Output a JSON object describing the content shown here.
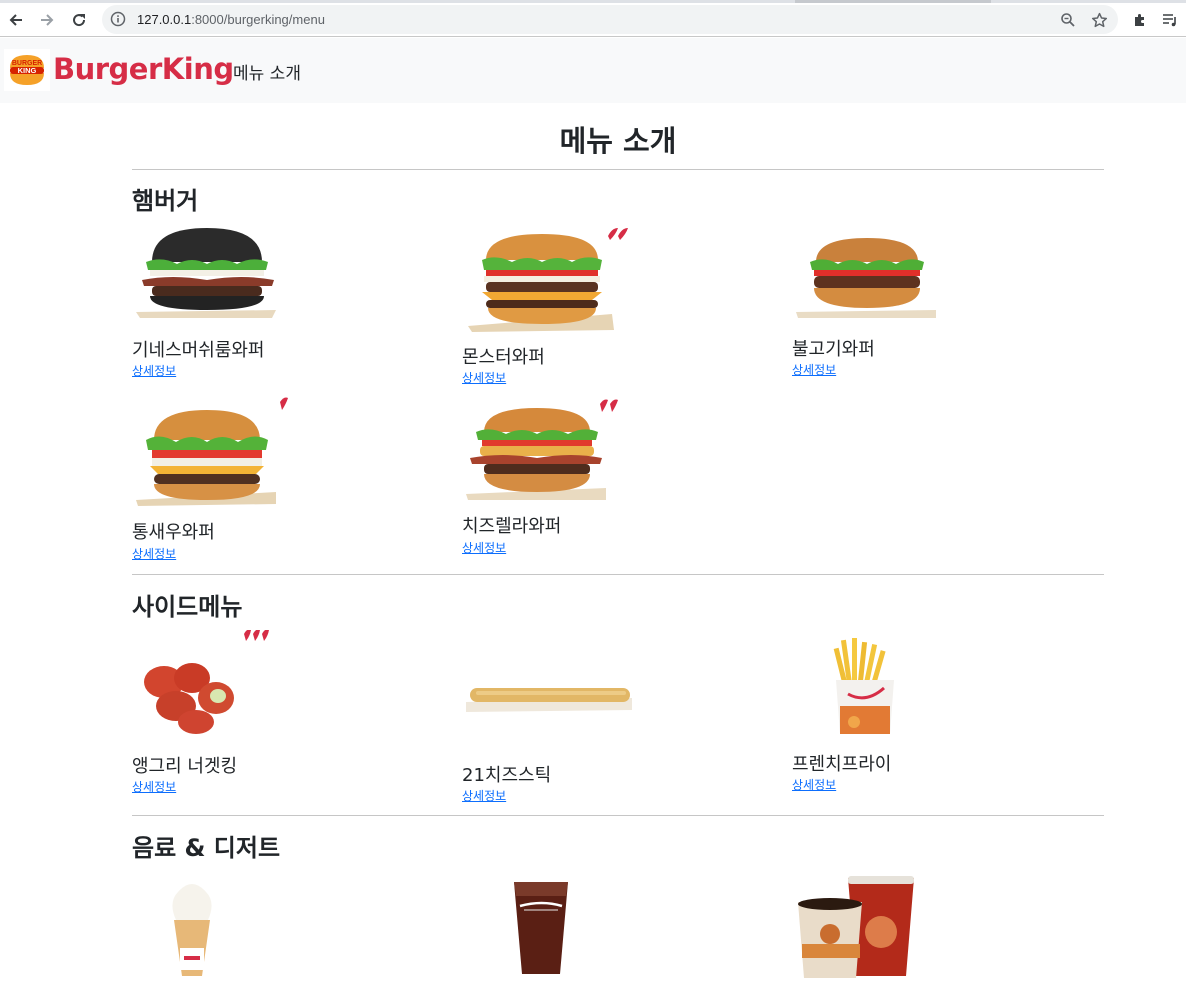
{
  "browser": {
    "url_host": "127.0.0.1",
    "url_rest": ":8000/burgerking/menu"
  },
  "navbar": {
    "logo_text_top": "BURGER",
    "logo_text_bottom": "KING",
    "brand": "BurgerKing",
    "link": "메뉴 소개"
  },
  "page": {
    "title": "메뉴 소개"
  },
  "sections": {
    "burger": {
      "title": "햄버거",
      "items": [
        {
          "name": "기네스머쉬룸와퍼",
          "link": "상세정보",
          "spicy": 0
        },
        {
          "name": "몬스터와퍼",
          "link": "상세정보",
          "spicy": 2
        },
        {
          "name": "불고기와퍼",
          "link": "상세정보",
          "spicy": 0
        },
        {
          "name": "통새우와퍼",
          "link": "상세정보",
          "spicy": 1
        },
        {
          "name": "치즈렐라와퍼",
          "link": "상세정보",
          "spicy": 2
        }
      ]
    },
    "side": {
      "title": "사이드메뉴",
      "items": [
        {
          "name": "앵그리 너겟킹",
          "link": "상세정보",
          "spicy": 3
        },
        {
          "name": "21치즈스틱",
          "link": "상세정보",
          "spicy": 0
        },
        {
          "name": "프렌치프라이",
          "link": "상세정보",
          "spicy": 0
        }
      ]
    },
    "drink": {
      "title": "음료 & 디저트",
      "items": [
        {
          "image": "soft-serve-cone"
        },
        {
          "image": "iced-cola"
        },
        {
          "image": "coffee-and-iced-tea"
        }
      ]
    }
  },
  "colors": {
    "brand": "#d62d46",
    "link": "#0d6efd",
    "navbar_bg": "#f8f9fa"
  }
}
